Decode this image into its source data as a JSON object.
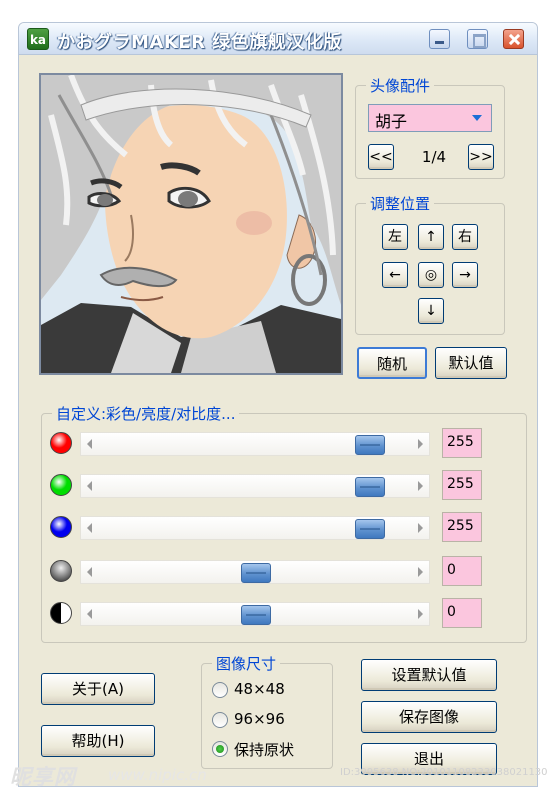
{
  "window": {
    "title": "かおグラMAKER 绿色旗舰汉化版",
    "app_icon_text": "ka"
  },
  "parts_panel": {
    "title": "头像配件",
    "selected_part": "胡子",
    "prev_label": "<<",
    "page_indicator": "1/4",
    "next_label": ">>"
  },
  "position_panel": {
    "title": "调整位置",
    "left_label": "左",
    "up_label": "↑",
    "right_label": "右",
    "move_left_label": "←",
    "center_label": "◎",
    "move_right_label": "→",
    "down_label": "↓"
  },
  "actions": {
    "random_label": "随机",
    "default_label": "默认值"
  },
  "custom_panel": {
    "title": "自定义:彩色/亮度/对比度...",
    "sliders": [
      {
        "name": "red",
        "color": "#ff0000",
        "value": "255",
        "level": 0.9
      },
      {
        "name": "green",
        "color": "#00dd00",
        "value": "255",
        "level": 0.9
      },
      {
        "name": "blue",
        "color": "#0000ee",
        "value": "255",
        "level": 0.9
      },
      {
        "name": "brightness",
        "color": "#333333",
        "value": "0",
        "level": 0.5
      },
      {
        "name": "contrast",
        "color": "#000000",
        "value": "0",
        "level": 0.5
      }
    ]
  },
  "size_panel": {
    "title": "图像尺寸",
    "options": [
      "48×48",
      "96×96",
      "保持原状"
    ],
    "selected": "保持原状"
  },
  "buttons": {
    "about": "关于(A)",
    "help": "帮助(H)",
    "set_default": "设置默认值",
    "save_image": "保存图像",
    "exit": "退出"
  },
  "watermark": {
    "logo": "昵享网",
    "url": "www.nipic.cn",
    "id_text": "ID:3995638 NO:20101108233038021130"
  }
}
